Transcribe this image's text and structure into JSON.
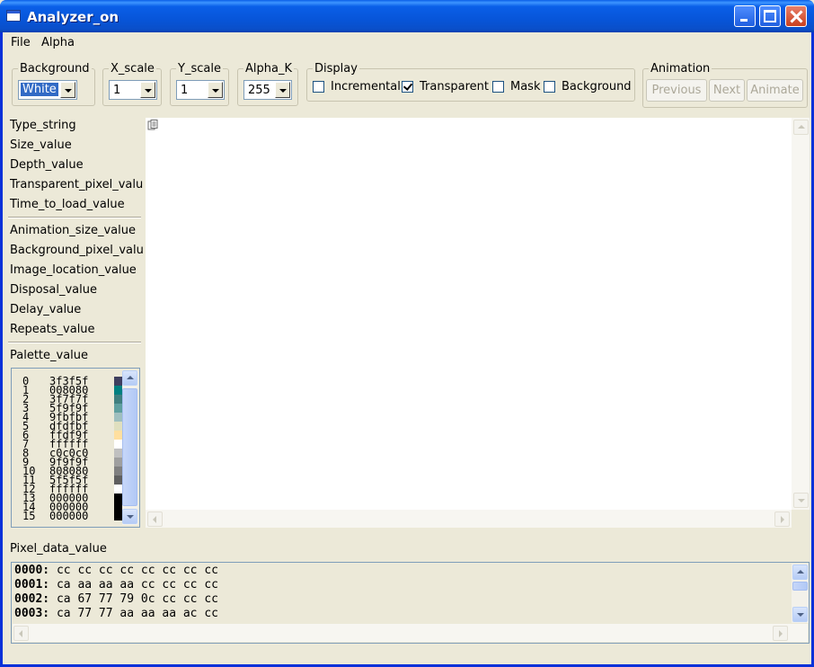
{
  "window": {
    "title": "Analyzer_on"
  },
  "menu": [
    "File",
    "Alpha"
  ],
  "controls": {
    "background": {
      "label": "Background",
      "value": "White"
    },
    "x_scale": {
      "label": "X_scale",
      "value": "1"
    },
    "y_scale": {
      "label": "Y_scale",
      "value": "1"
    },
    "alpha_k": {
      "label": "Alpha_K",
      "value": "255"
    }
  },
  "display": {
    "label": "Display",
    "options": [
      {
        "label": "Incremental",
        "checked": false
      },
      {
        "label": "Transparent",
        "checked": true
      },
      {
        "label": "Mask",
        "checked": false
      },
      {
        "label": "Background",
        "checked": false
      }
    ]
  },
  "animation": {
    "label": "Animation",
    "buttons": [
      "Previous",
      "Next",
      "Animate"
    ]
  },
  "info": {
    "group1": [
      "Type_string",
      "Size_value",
      "Depth_value",
      "Transparent_pixel_value",
      "Time_to_load_value"
    ],
    "group2": [
      "Animation_size_value",
      "Background_pixel_value",
      "Image_location_value",
      "Disposal_value",
      "Delay_value",
      "Repeats_value"
    ],
    "palette_label": "Palette_value",
    "pixel_data_label": "Pixel_data_value"
  },
  "palette": [
    {
      "index": "0",
      "hex": "3f3f5f",
      "color": "#3f3f5f"
    },
    {
      "index": "1",
      "hex": "008080",
      "color": "#008080"
    },
    {
      "index": "2",
      "hex": "3f7f7f",
      "color": "#3f7f7f"
    },
    {
      "index": "3",
      "hex": "5f9f9f",
      "color": "#5f9f9f"
    },
    {
      "index": "4",
      "hex": "9fbfbf",
      "color": "#9fbfbf"
    },
    {
      "index": "5",
      "hex": "dfdfbf",
      "color": "#dfdfbf"
    },
    {
      "index": "6",
      "hex": "ffdf9f",
      "color": "#ffdf9f"
    },
    {
      "index": "7",
      "hex": "ffffff",
      "color": "#ffffff"
    },
    {
      "index": "8",
      "hex": "c0c0c0",
      "color": "#c0c0c0"
    },
    {
      "index": "9",
      "hex": "9f9f9f",
      "color": "#9f9f9f"
    },
    {
      "index": "10",
      "hex": "808080",
      "color": "#808080"
    },
    {
      "index": "11",
      "hex": "5f5f5f",
      "color": "#5f5f5f"
    },
    {
      "index": "12",
      "hex": "ffffff",
      "color": "#ffffff"
    },
    {
      "index": "13",
      "hex": "000000",
      "color": "#000000"
    },
    {
      "index": "14",
      "hex": "000000",
      "color": "#000000"
    },
    {
      "index": "15",
      "hex": "000000",
      "color": "#000000"
    }
  ],
  "pixel_data": [
    {
      "addr": "0000:",
      "bytes": "cc cc cc cc cc cc cc cc"
    },
    {
      "addr": "0001:",
      "bytes": "ca aa aa aa cc cc cc cc"
    },
    {
      "addr": "0002:",
      "bytes": "ca 67 77 79 0c cc cc cc"
    },
    {
      "addr": "0003:",
      "bytes": "ca 77 77 aa aa aa ac cc"
    }
  ]
}
